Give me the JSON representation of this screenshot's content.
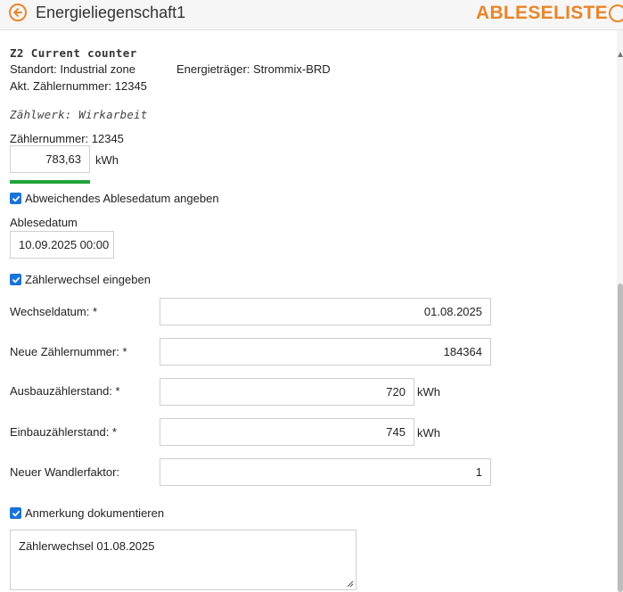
{
  "header": {
    "title": "Energieliegenschaft1",
    "action_label": "ABLESELISTE",
    "accent": "#e8862b",
    "back_icon": "arrow-left-circle-icon",
    "right_icon": "refresh-circle-icon"
  },
  "counter": {
    "title": "Z2 Current counter",
    "location": "Standort: Industrial zone",
    "energy_carrier": "Energieträger: Strommix-BRD",
    "current_number": "Akt. Zählernummer: 12345"
  },
  "register": {
    "title": "Zählwerk: Wirkarbeit",
    "meter_number": "Zählernummer: 12345",
    "reading_value": "783,63",
    "reading_unit": "kWh",
    "progress_color": "#21a33a"
  },
  "deviating_date": {
    "checked": true,
    "label": "Abweichendes Ablesedatum angeben",
    "date_label": "Ablesedatum",
    "date_value": "10.09.2025 00:00"
  },
  "meter_change": {
    "checked": true,
    "label": "Zählerwechsel eingeben",
    "fields": {
      "change_date_label": "Wechseldatum: *",
      "change_date_value": "01.08.2025",
      "new_number_label": "Neue Zählernummer: *",
      "new_number_value": "184364",
      "removal_label": "Ausbauzählerstand: *",
      "removal_value": "720",
      "removal_unit": "kWh",
      "install_label": "Einbauzählerstand: *",
      "install_value": "745",
      "install_unit": "kWh",
      "factor_label": "Neuer Wandlerfaktor:",
      "factor_value": "1"
    }
  },
  "remark": {
    "checked": true,
    "label": "Anmerkung dokumentieren",
    "text": "Zählerwechsel 01.08.2025"
  },
  "checkbox_color": "#1a73d9"
}
